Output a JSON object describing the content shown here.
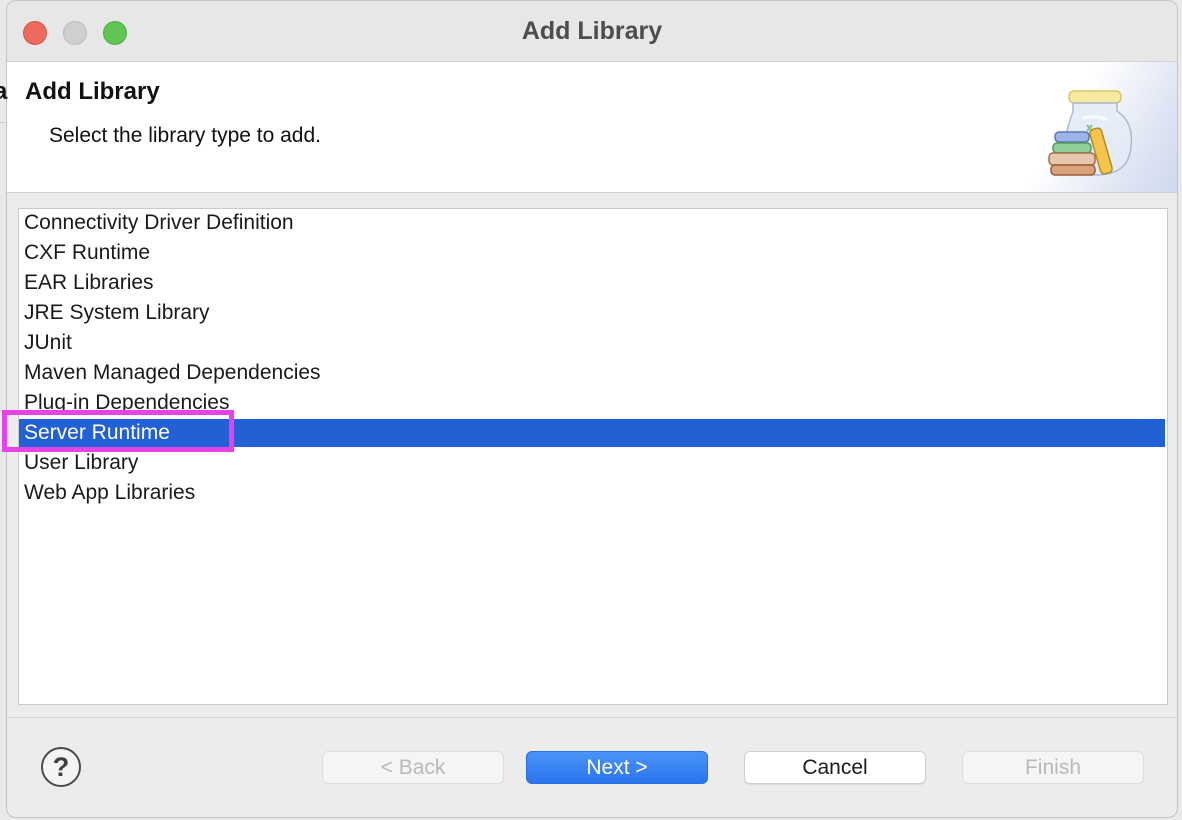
{
  "window": {
    "title": "Add Library",
    "controls": [
      "close",
      "minimize",
      "maximize"
    ]
  },
  "header": {
    "title": "Add Library",
    "description": "Select the library type to add.",
    "edge_fragment": "a",
    "icon": "library-jar-icon"
  },
  "library_types": {
    "items": [
      "Connectivity Driver Definition",
      "CXF Runtime",
      "EAR Libraries",
      "JRE System Library",
      "JUnit",
      "Maven Managed Dependencies",
      "Plug-in Dependencies",
      "Server Runtime",
      "User Library",
      "Web App Libraries"
    ],
    "selected": "Server Runtime"
  },
  "buttons": {
    "help_icon": "?",
    "back": "< Back",
    "next": "Next >",
    "cancel": "Cancel",
    "finish": "Finish"
  },
  "colors": {
    "selection": "#2260d6",
    "highlight_outline": "#e542ea",
    "primary_button": "#2a74ee"
  }
}
